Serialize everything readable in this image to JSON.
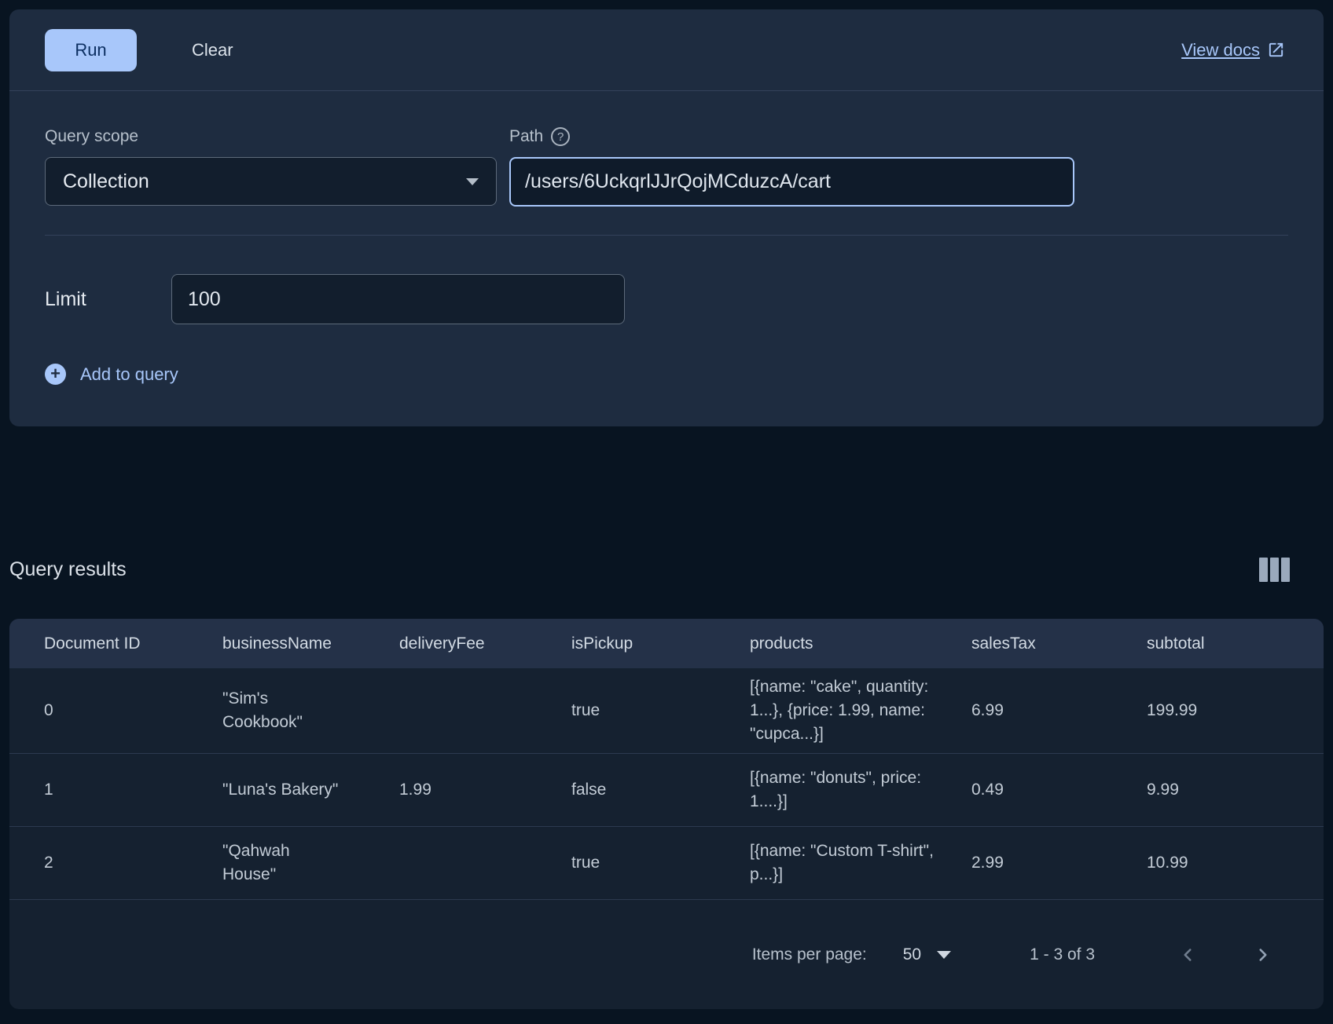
{
  "colors": {
    "accent": "#a8c7fa",
    "page_bg": "#081421",
    "panel_bg": "#1e2c40",
    "card_bg": "#152130",
    "table_header_bg": "#243148",
    "run_button_text": "#0c3166"
  },
  "query_builder": {
    "run_label": "Run",
    "clear_label": "Clear",
    "view_docs_label": "View docs",
    "query_scope_label": "Query scope",
    "query_scope_value": "Collection",
    "path_label": "Path",
    "path_value": "/users/6UckqrlJJrQojMCduzcA/cart",
    "limit_label": "Limit",
    "limit_value": "100",
    "add_to_query_label": "Add to query"
  },
  "results": {
    "title": "Query results",
    "columns": [
      "Document ID",
      "businessName",
      "deliveryFee",
      "isPickup",
      "products",
      "salesTax",
      "subtotal"
    ],
    "rows": [
      [
        "0",
        "\"Sim's Cookbook\"",
        "",
        "true",
        "[{name: \"cake\", quantity: 1...}, {price: 1.99, name: \"cupca...}]",
        "6.99",
        "199.99"
      ],
      [
        "1",
        "\"Luna's Bakery\"",
        "1.99",
        "false",
        "[{name: \"donuts\", price: 1....}]",
        "0.49",
        "9.99"
      ],
      [
        "2",
        "\"Qahwah House\"",
        "",
        "true",
        "[{name: \"Custom T-shirt\", p...}]",
        "2.99",
        "10.99"
      ]
    ],
    "pagination": {
      "items_per_page_label": "Items per page:",
      "items_per_page_value": "50",
      "range_label": "1 - 3 of 3"
    }
  }
}
